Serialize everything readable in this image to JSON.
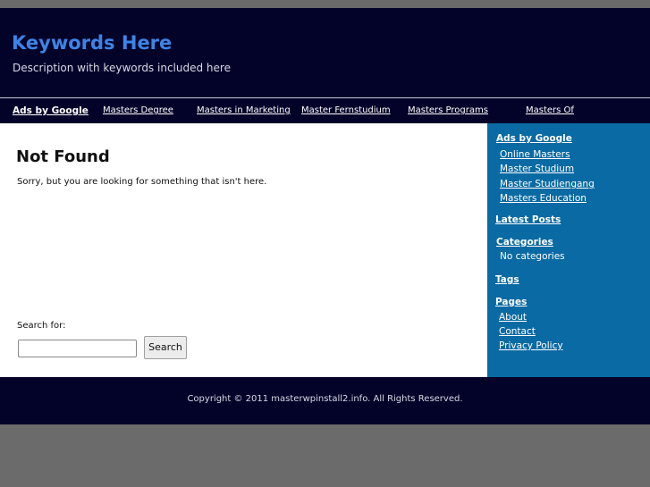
{
  "header": {
    "title": "Keywords Here",
    "description": "Description with keywords included here"
  },
  "nav": {
    "items": [
      {
        "label": "Ads by Google"
      },
      {
        "label": "Masters Degree"
      },
      {
        "label": "Masters in Marketing"
      },
      {
        "label": "Master Fernstudium"
      },
      {
        "label": "Masters Programs"
      },
      {
        "label": "Masters Of"
      }
    ]
  },
  "main": {
    "title": "Not Found",
    "message": "Sorry, but you are looking for something that isn't here.",
    "search_label": "Search for:",
    "search_value": "",
    "search_button": "Search"
  },
  "sidebar": {
    "ads_heading": "Ads by Google",
    "ads": [
      "Online Masters",
      "Master Studium",
      "Master Studiengang",
      "Masters Education"
    ],
    "latest_posts": "Latest Posts",
    "categories_heading": "Categories",
    "categories_empty": "No categories",
    "tags": "Tags",
    "pages_heading": "Pages",
    "pages": [
      "About",
      "Contact",
      "Privacy Policy"
    ]
  },
  "footer": {
    "copyright": "Copyright © 2011 masterwpinstall2.info. All Rights Reserved."
  },
  "colors": {
    "header_bg": "#03032a",
    "title": "#3d84e6",
    "sidebar_bg": "#0a6aa3",
    "page_bg": "#6b6b6b"
  }
}
